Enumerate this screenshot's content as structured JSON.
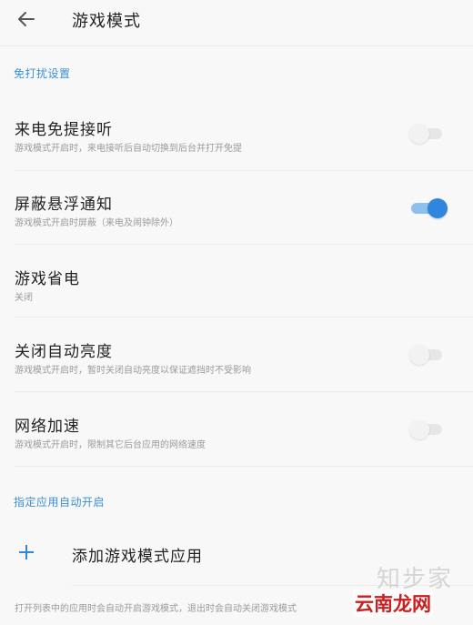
{
  "header": {
    "title": "游戏模式",
    "back_icon": "arrow-left-icon"
  },
  "sections": {
    "dnd_title": "免打扰设置",
    "apps_title": "指定应用自动开启"
  },
  "settings": [
    {
      "title": "来电免提接听",
      "desc": "游戏模式开启时，来电接听后自动切换到后台并打开免提",
      "toggle": "off"
    },
    {
      "title": "屏蔽悬浮通知",
      "desc": "游戏模式开启时屏蔽（来电及闹钟除外）",
      "toggle": "on"
    },
    {
      "title": "游戏省电",
      "desc": "关闭",
      "toggle": "none"
    },
    {
      "title": "关闭自动亮度",
      "desc": "游戏模式开启时，暂时关闭自动亮度以保证遮挡时不受影响",
      "toggle": "off"
    },
    {
      "title": "网络加速",
      "desc": "游戏模式开启时，限制其它后台应用的网络速度",
      "toggle": "off"
    }
  ],
  "add_app": {
    "label": "添加游戏模式应用",
    "icon": "plus-icon"
  },
  "footer": {
    "text": "打开列表中的应用时会自动开启游戏模式，退出时会自动关闭游戏模式"
  },
  "watermark": {
    "top": "知步家",
    "bottom": "云南龙网"
  },
  "colors": {
    "accent": "#2f86dc",
    "section_title": "#3a8fd4",
    "background": "#f8f8f8"
  }
}
